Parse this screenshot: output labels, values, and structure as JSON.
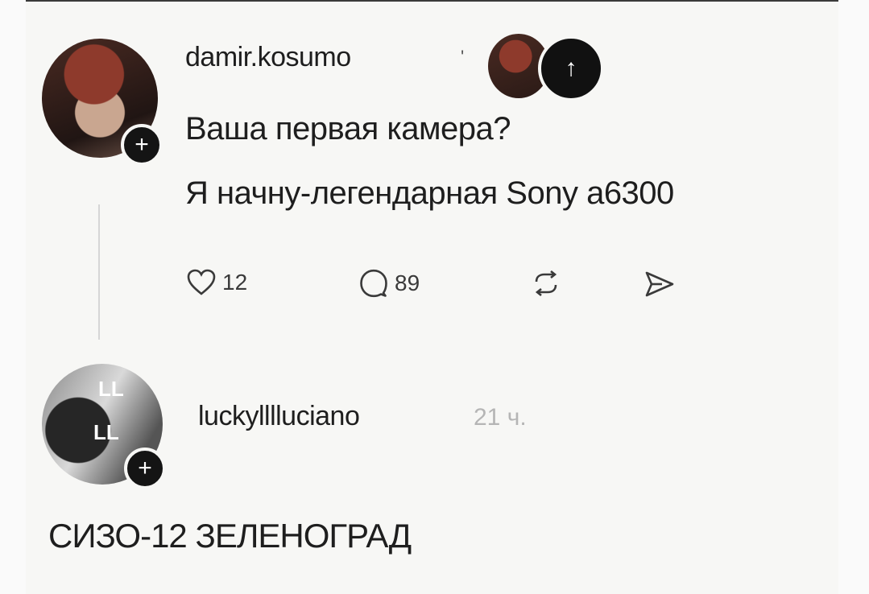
{
  "post": {
    "username": "damir.kosumo",
    "username_tick": "'",
    "line1": "Ваша первая камера?",
    "line2": "Я начну-легендарная Sony a6300",
    "likes": "12",
    "comments": "89"
  },
  "reply": {
    "username": "luckylllluciano",
    "time": "21 ч.",
    "avatar_mark_top": "LL",
    "avatar_mark_bottom": "LL",
    "text": "СИЗО-12 ЗЕЛЕНОГРАД"
  },
  "icons": {
    "follow": "plus-icon",
    "upload": "arrow-up-icon",
    "like": "heart-icon",
    "comment": "comment-bubble-icon",
    "repost": "repost-icon",
    "share": "send-icon"
  }
}
